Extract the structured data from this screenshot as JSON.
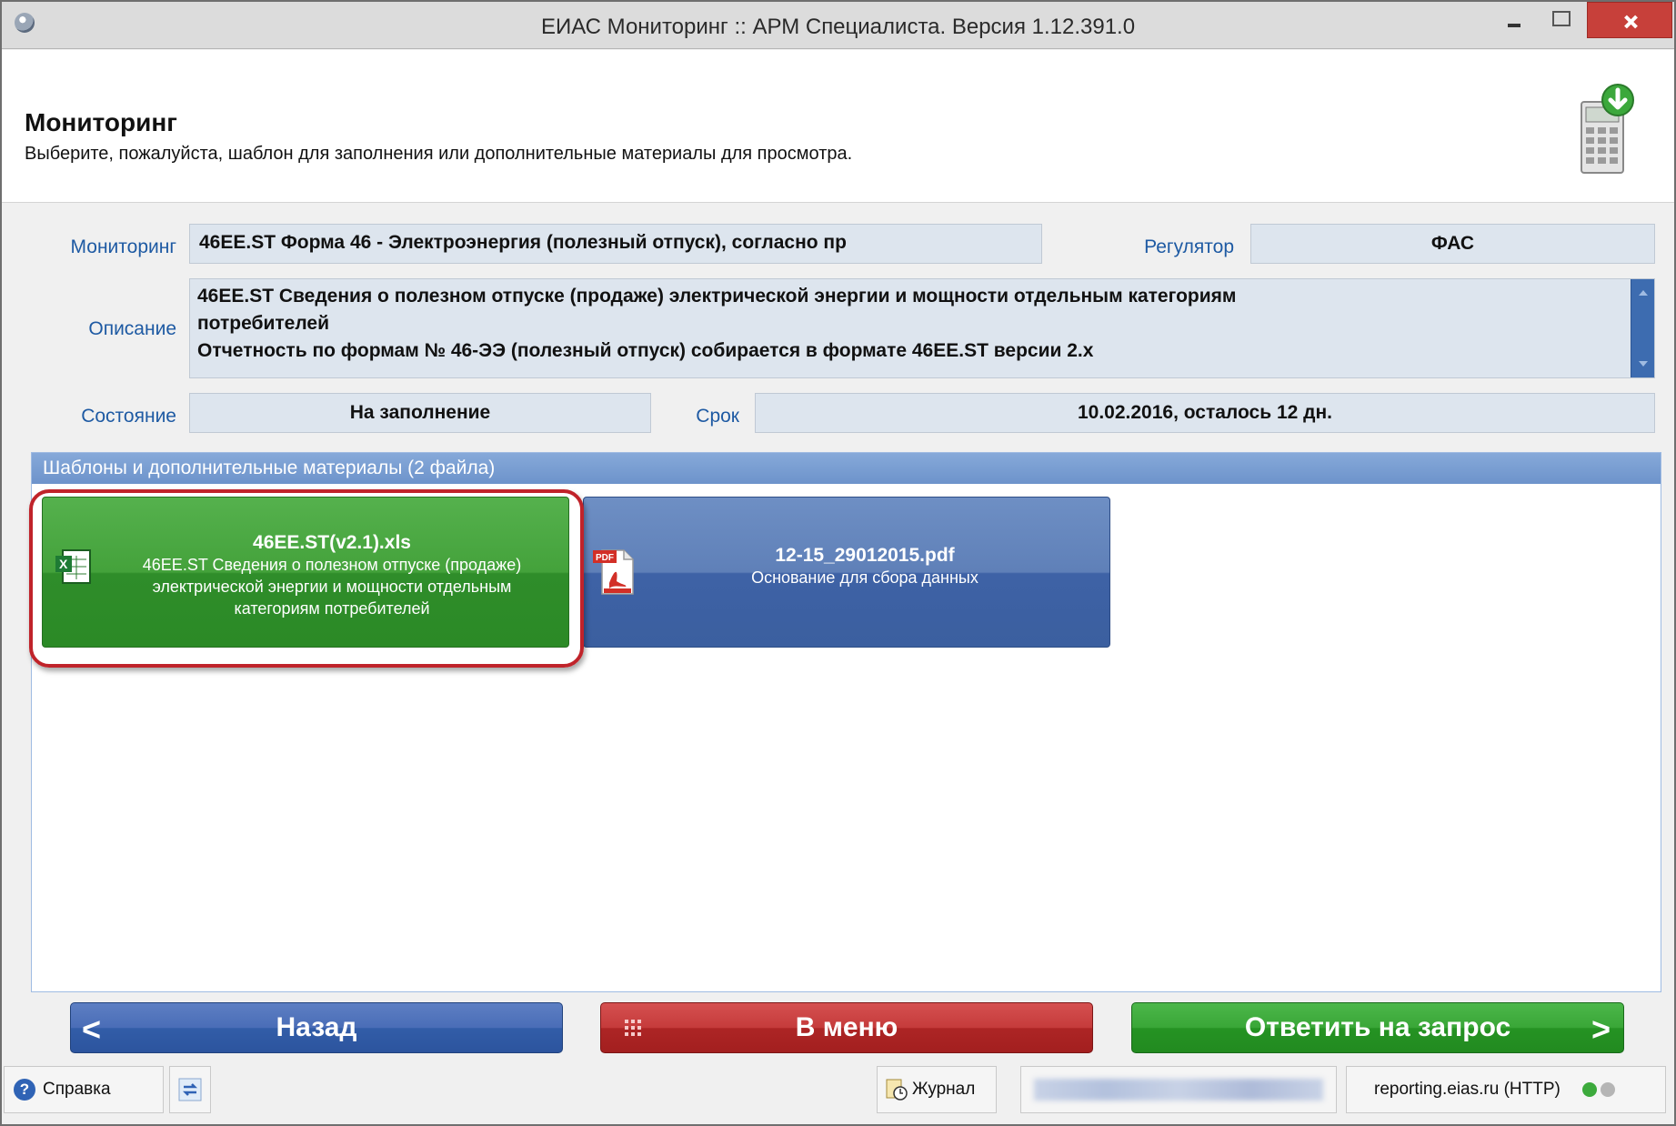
{
  "window": {
    "title": "ЕИАС Мониторинг :: АРМ Специалиста. Версия 1.12.391.0"
  },
  "header": {
    "title": "Мониторинг",
    "subtitle": "Выберите, пожалуйста, шаблон для заполнения или дополнительные материалы для просмотра."
  },
  "form": {
    "monitoring_label": "Мониторинг",
    "monitoring_value": "46EE.ST  Форма 46 - Электроэнергия (полезный отпуск), согласно пр",
    "regulator_label": "Регулятор",
    "regulator_value": "ФАС",
    "description_label": "Описание",
    "description_lines": [
      "46EE.ST  Сведения о полезном отпуске (продаже) электрической энергии и мощности отдельным категориям",
      "потребителей",
      "Отчетность по формам № 46-ЭЭ (полезный отпуск) собирается в формате 46EE.ST версии 2.х"
    ],
    "state_label": "Состояние",
    "state_value": "На заполнение",
    "deadline_label": "Срок",
    "deadline_value": "10.02.2016, осталось 12 дн."
  },
  "files_panel": {
    "header": "Шаблоны и дополнительные материалы (2 файла)",
    "files": [
      {
        "icon": "excel-file-icon",
        "name": "46EE.ST(v2.1).xls",
        "desc_lines": [
          "46EE.ST Сведения о полезном отпуске (продаже)",
          "электрической энергии и мощности отдельным",
          "категориям потребителей"
        ],
        "color": "#3a9b33"
      },
      {
        "icon": "pdf-file-icon",
        "name": "12-15_29012015.pdf",
        "desc_lines": [
          "Основание для сбора данных"
        ],
        "color": "#3e62a6"
      }
    ]
  },
  "buttons": {
    "back": "Назад",
    "menu": "В меню",
    "answer": "Ответить на запрос"
  },
  "statusbar": {
    "help": "Справка",
    "journal": "Журнал",
    "server": "reporting.eias.ru (HTTP)",
    "led_colors": [
      "#3caa3c",
      "#b5b5b5"
    ]
  }
}
